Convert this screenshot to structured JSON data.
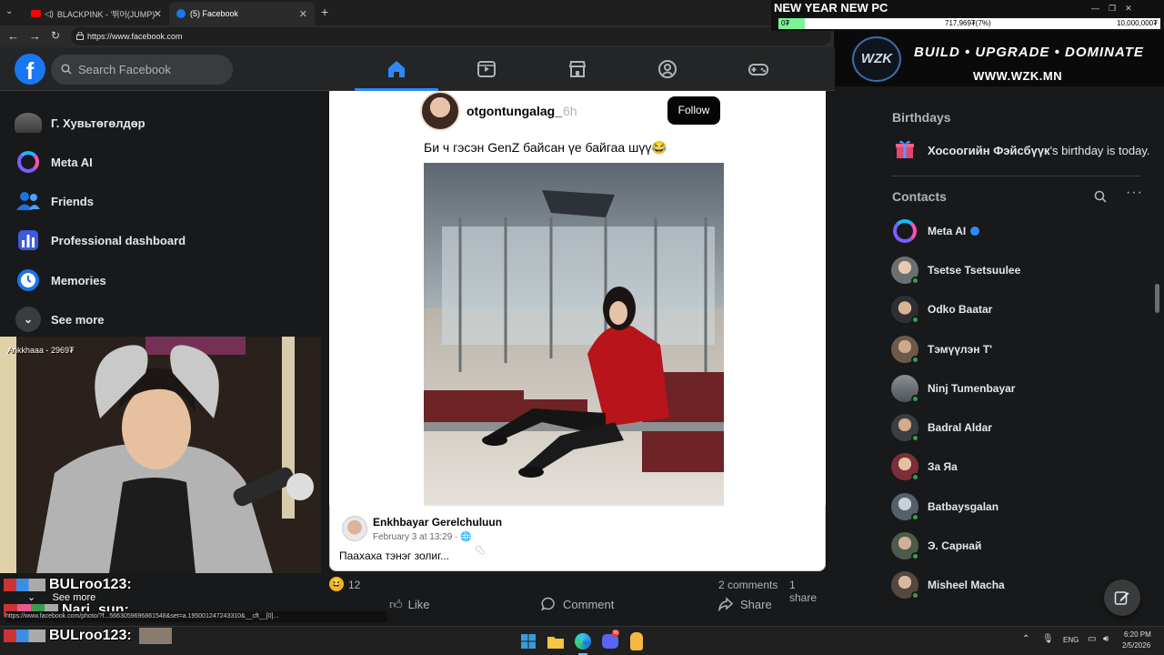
{
  "browser": {
    "tabs": [
      {
        "label": "BLACKPINK - '뛰어(JUMP)' M/"
      },
      {
        "label": "(5) Facebook"
      }
    ],
    "url": "https://www.facebook.com"
  },
  "header": {
    "logo": "f",
    "search_placeholder": "Search Facebook"
  },
  "sidebar": {
    "items": [
      {
        "label": "Г. Хувьтөгөлдөр"
      },
      {
        "label": "Meta AI"
      },
      {
        "label": "Friends"
      },
      {
        "label": "Professional dashboard"
      },
      {
        "label": "Memories"
      },
      {
        "label": "See more"
      }
    ]
  },
  "post": {
    "username": "otgontungalag_",
    "time": "6h",
    "follow_label": "Follow",
    "caption": "Би ч гэсэн GenZ байсан үе байгаа шүү😂",
    "comment": {
      "name": "Enkhbayar Gerelchuluun",
      "meta": "February 3 at 13:29 · 🌐",
      "text": "Пааxаха тэнэг золиг..."
    },
    "reaction_count": "12",
    "comments_count": "2 comments",
    "shares_count": "1 share",
    "actions": {
      "like": "Like",
      "comment": "Comment",
      "share": "Share"
    }
  },
  "right": {
    "birthdays_title": "Birthdays",
    "birthday_name": "Хосоогийн Фэйсбүүк",
    "birthday_suffix": "'s birthday is today.",
    "contacts_title": "Contacts",
    "contacts": [
      {
        "name": "Meta AI"
      },
      {
        "name": "Tsetse Tsetsuulee"
      },
      {
        "name": "Odko Baatar"
      },
      {
        "name": "Тэмүүлэн Т'"
      },
      {
        "name": "Ninj Tumenbayar"
      },
      {
        "name": "Badral Aldar"
      },
      {
        "name": "За Яа"
      },
      {
        "name": "Batbaysgalan"
      },
      {
        "name": "Э. Сарнай"
      },
      {
        "name": "Misheel Macha"
      }
    ]
  },
  "overlay": {
    "promo_title": "NEW YEAR NEW PC",
    "promo_start": "0₮",
    "promo_progress": "717,969₮(7%)",
    "promo_goal": "10,000,000₮",
    "banner_tagline": "BUILD • UPGRADE • DOMINATE",
    "banner_url": "WWW.WZK.MN",
    "banner_logo": "WZK",
    "webcam_label": "Ankkhaaa - 2969₮",
    "chat": [
      {
        "text": "BULroo123:"
      },
      {
        "text": "Nari_sun:"
      },
      {
        "text": "BULroo123:"
      }
    ],
    "status_url": "https://www.facebook.com/photo/?f...5663059696861548&set=a.195001247243310&__cft__[0]...",
    "see_more_overlay": "See more"
  },
  "taskbar": {
    "lang": "ENG",
    "time": "6:20 PM",
    "date": "2/5/2026"
  },
  "colors": {
    "fb_blue": "#1877f2",
    "bg_dark": "#18191a",
    "panel": "#242526",
    "online": "#31a24c"
  }
}
